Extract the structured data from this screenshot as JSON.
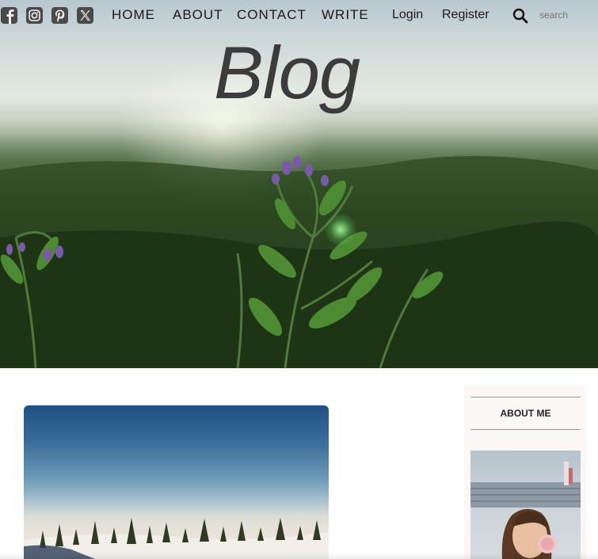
{
  "header": {
    "social_icons": [
      "facebook-icon",
      "instagram-icon",
      "pinterest-icon",
      "x-twitter-icon"
    ],
    "nav": [
      "HOME",
      "ABOUT",
      "CONTACT",
      "WRITE"
    ],
    "auth": {
      "login": "Login",
      "register": "Register"
    },
    "search": {
      "icon": "search-icon",
      "placeholder": "search"
    }
  },
  "hero": {
    "title": "Blog"
  },
  "sidebar": {
    "about_title": "ABOUT ME"
  },
  "colors": {
    "text": "#1a1a1a",
    "hero_title": "#3c3c3c",
    "search_placeholder": "#c9a15c",
    "sidebar_bg": "#fbf7f4"
  }
}
